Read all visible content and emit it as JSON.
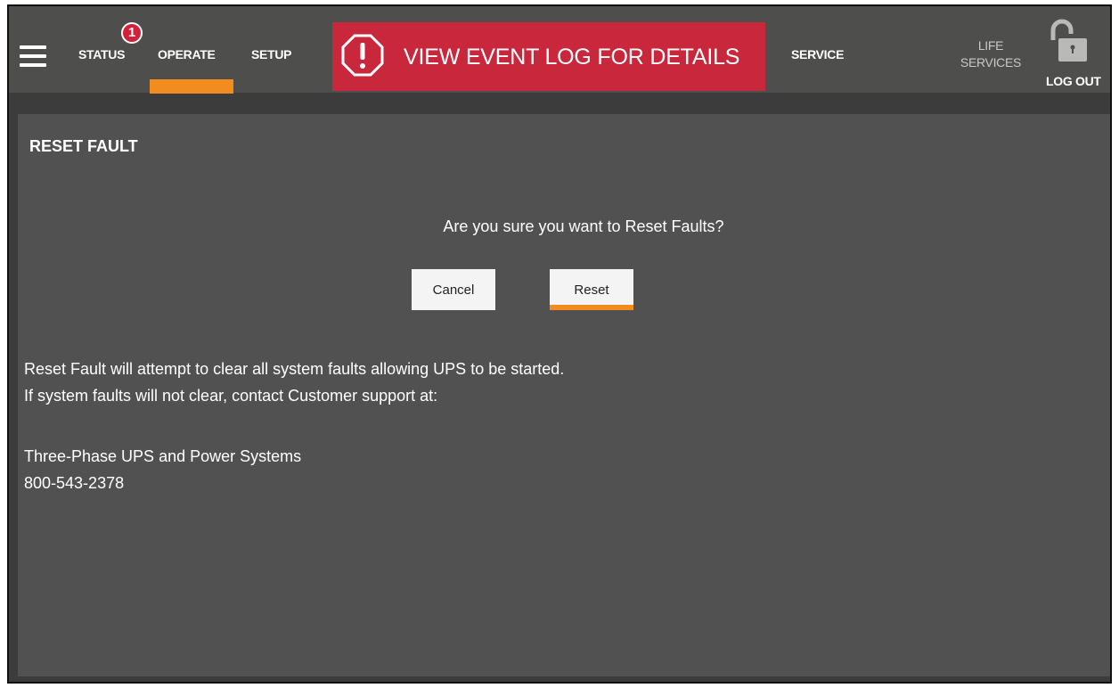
{
  "nav": {
    "status_label": "STATUS",
    "status_badge": "1",
    "operate_label": "OPERATE",
    "setup_label": "SETUP",
    "service_label": "SERVICE",
    "life_services_line1": "LIFE",
    "life_services_line2": "SERVICES",
    "logout_label": "LOG OUT",
    "active_tab": "OPERATE"
  },
  "alert_banner": {
    "text": "VIEW EVENT LOG FOR DETAILS",
    "icon": "alert-octagon-icon",
    "color": "#c8273c"
  },
  "page": {
    "title": "RESET FAULT",
    "question": "Are you sure you want to Reset Faults?",
    "cancel_label": "Cancel",
    "reset_label": "Reset",
    "info_line_1": "Reset Fault will attempt to clear all system faults allowing UPS to be started.",
    "info_line_2": "If system faults will not clear, contact Customer support at:",
    "contact_name": "Three-Phase UPS and Power Systems",
    "contact_phone": "800-543-2378"
  },
  "colors": {
    "accent": "#f28c1e",
    "badge": "#d3213a",
    "topbar": "#4e4f4d",
    "panel": "#505150"
  }
}
